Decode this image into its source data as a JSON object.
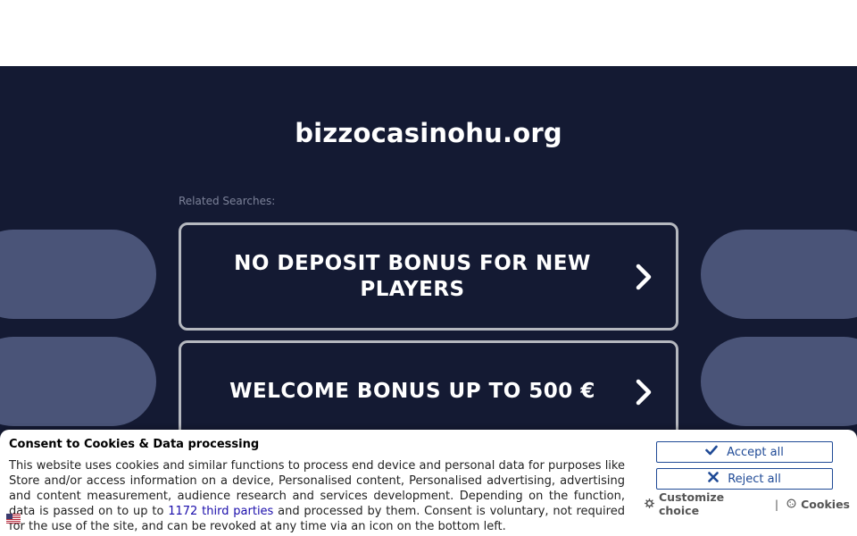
{
  "page": {
    "domain": "bizzocasinohu.org",
    "related_label": "Related Searches:"
  },
  "searches": [
    {
      "label": "NO DEPOSIT BONUS FOR NEW PLAYERS",
      "icon": "chevron-right-icon"
    },
    {
      "label": "WELCOME BONUS UP TO 500 €",
      "icon": "chevron-right-icon"
    }
  ],
  "consent": {
    "title": "Consent to Cookies & Data processing",
    "body_part1": "This website uses cookies and similar functions to process end device and personal data for purposes like Store and/or access information on a device, Personalised content, Personalised advertising, advertising and content measurement, audience research and services development. Depending on the function, data is passed on to up to ",
    "third_parties_link": "1172 third parties",
    "body_part2": " and processed by them. Consent is voluntary, not required for the use of the site, and can be revoked at any time via an icon on the bottom left.",
    "accept_label": "Accept all",
    "reject_label": "Reject all",
    "customize_label": "Customize choice",
    "separator": "|",
    "cookies_label": "Cookies"
  },
  "colors": {
    "hero_bg": "#141a33",
    "pill": "#4a5478",
    "card_border": "#b5b8bf",
    "button_accent": "#1f4a96",
    "link": "#1a0dab"
  }
}
